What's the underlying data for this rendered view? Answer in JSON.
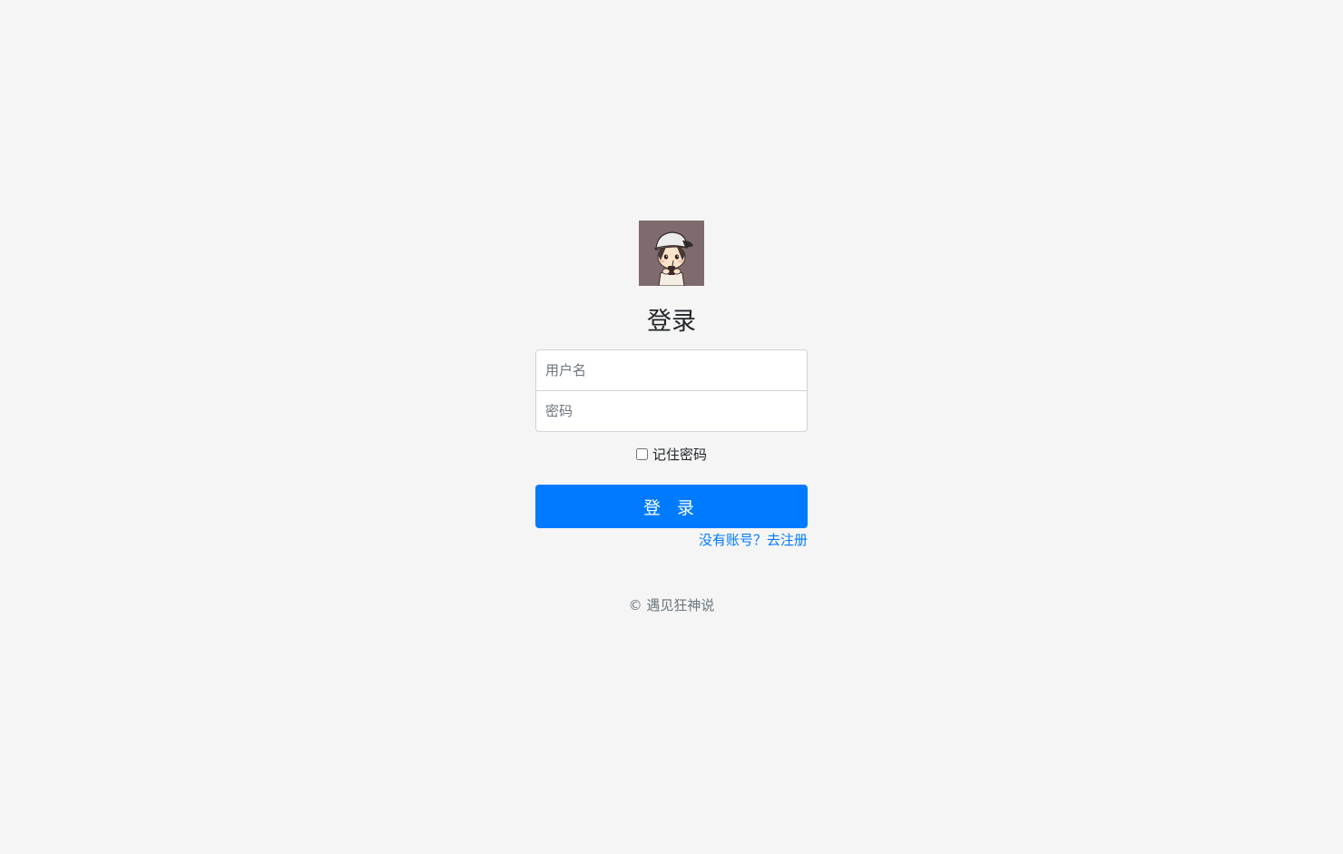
{
  "login": {
    "title": "登录",
    "username_placeholder": "用户名",
    "password_placeholder": "密码",
    "remember_label": "记住密码",
    "submit_label": "登 录",
    "register_link": "没有账号？去注册",
    "footer": "© 遇见狂神说"
  },
  "colors": {
    "background": "#f5f5f5",
    "primary": "#007bff",
    "avatar_bg": "#7f6b6d"
  },
  "icons": {
    "avatar": "cartoon-boy-avatar"
  }
}
